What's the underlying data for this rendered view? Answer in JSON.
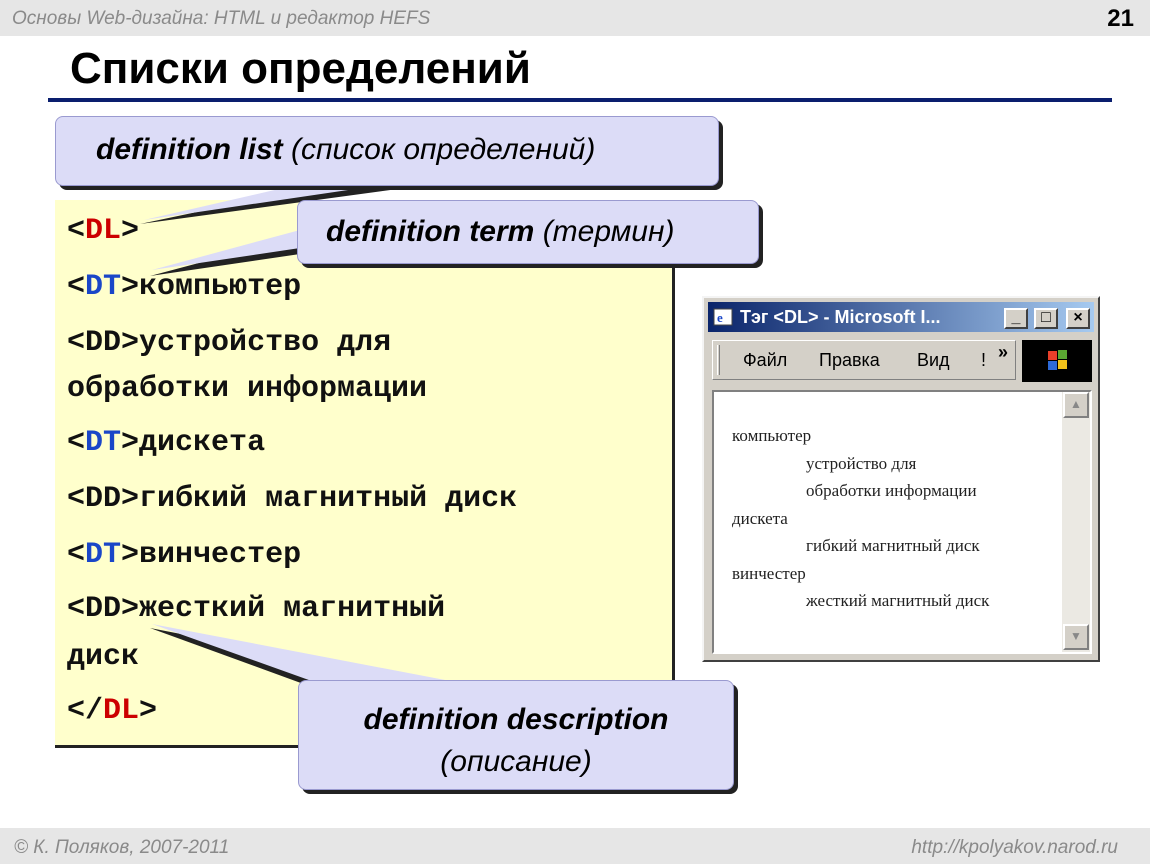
{
  "header": {
    "course_title": "Основы Web-дизайна: HTML и редактор HEFS",
    "page_number": "21"
  },
  "slide": {
    "title": "Списки определений"
  },
  "code": {
    "lines": [
      {
        "open": "<",
        "tag": "DL",
        "close": ">",
        "text": "",
        "tag_color": "red"
      },
      {
        "open": "<",
        "tag": "DT",
        "close": ">",
        "text": "компьютер",
        "tag_color": "blue"
      },
      {
        "open": "<",
        "tag": "DD",
        "close": ">",
        "text": "устройство для",
        "tag_color": "none"
      },
      {
        "open": "",
        "tag": "",
        "close": "",
        "text": "обработки информации",
        "tag_color": "none"
      },
      {
        "open": "<",
        "tag": "DT",
        "close": ">",
        "text": "дискета",
        "tag_color": "blue"
      },
      {
        "open": "<",
        "tag": "DD",
        "close": ">",
        "text": "гибкий магнитный диск",
        "tag_color": "none"
      },
      {
        "open": "<",
        "tag": "DT",
        "close": ">",
        "text": "винчестер",
        "tag_color": "blue"
      },
      {
        "open": "<",
        "tag": "DD",
        "close": ">",
        "text": "жесткий магнитный",
        "tag_color": "none"
      },
      {
        "open": "",
        "tag": "",
        "close": "",
        "text": "диск",
        "tag_color": "none"
      },
      {
        "open": "</",
        "tag": "DL",
        "close": ">",
        "text": "",
        "tag_color": "red"
      }
    ]
  },
  "callouts": {
    "dl": {
      "term": "definition list",
      "note": "(список определений)"
    },
    "dt": {
      "term": "definition term",
      "note": "(термин)"
    },
    "dd": {
      "term": "definition description",
      "note": "(описание)"
    }
  },
  "browser": {
    "title": "Тэг <DL> - Microsoft I...",
    "buttons": {
      "minimize": "_",
      "maximize": "□",
      "close": "×"
    },
    "menu": [
      "Файл",
      "Правка",
      "Вид",
      "!"
    ],
    "menu_more": "»",
    "rendered": [
      {
        "kind": "term",
        "text": "компьютер"
      },
      {
        "kind": "desc",
        "text": "устройство для"
      },
      {
        "kind": "desc",
        "text": "обработки информации"
      },
      {
        "kind": "term",
        "text": "дискета"
      },
      {
        "kind": "desc",
        "text": "гибкий магнитный диск"
      },
      {
        "kind": "term",
        "text": "винчестер"
      },
      {
        "kind": "desc",
        "text": "жесткий магнитный диск"
      }
    ],
    "scroll_up": "▲",
    "scroll_down": "▼"
  },
  "footer": {
    "copyright": "© К. Поляков, 2007-2011",
    "url": "http://kpolyakov.narod.ru"
  },
  "colors": {
    "tag_red": "#cc0000",
    "tag_blue": "#1a46c8",
    "callout_bg": "#dcdcf7",
    "code_bg": "#ffffcc",
    "title_rule": "#0a1e6e"
  }
}
